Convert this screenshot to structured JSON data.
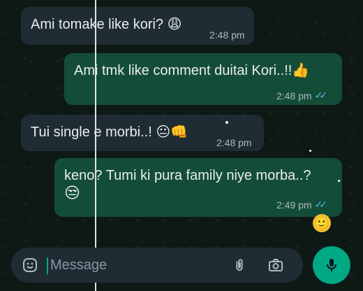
{
  "messages": [
    {
      "text": "Ami tomake like kori? 😩",
      "time": "2:48 pm",
      "dir": "in"
    },
    {
      "text": "Ami tmk like comment duitai Kori..!!👍",
      "time": "2:48 pm",
      "dir": "out",
      "ticks": "✓✓"
    },
    {
      "text": "Tui single e morbi..! 😐👊",
      "time": "2:48 pm",
      "dir": "in"
    },
    {
      "text": "keno? Tumi ki pura family niye morba..?",
      "emoji": "😒",
      "time": "2:49 pm",
      "dir": "out",
      "ticks": "✓✓"
    }
  ],
  "reaction_emoji": "🙂",
  "composer": {
    "placeholder": "Message",
    "icons": [
      "sticker-icon",
      "attach-icon",
      "camera-icon",
      "mic-icon"
    ]
  },
  "colors": {
    "incoming": "#1f2c33",
    "outgoing": "#144d37",
    "accent": "#00a884",
    "read_ticks": "#53bdeb"
  }
}
